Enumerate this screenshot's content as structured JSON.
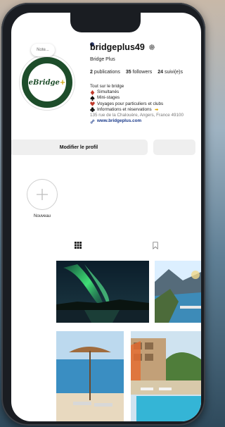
{
  "profile": {
    "username": "bridgeplus49",
    "display_name": "Bridge Plus",
    "note": "Note...",
    "avatar_logo": {
      "prefix": "e",
      "main": "Bridge",
      "suffix": "+"
    }
  },
  "stats": {
    "publications_count": "2",
    "publications_label": "publications",
    "followers_count": "35",
    "followers_label": "followers",
    "following_count": "24",
    "following_label": "suivi(e)s"
  },
  "bio": {
    "intro": "Tout sur le bridge",
    "items": [
      {
        "icon": "diamond-suit-icon",
        "text": "Simultanés",
        "color": "#c0392b"
      },
      {
        "icon": "spade-suit-icon",
        "text": "Mini-stages",
        "color": "#111111"
      },
      {
        "icon": "heart-suit-icon",
        "text": "Voyages pour particuliers et clubs",
        "color": "#c0392b"
      },
      {
        "icon": "club-suit-icon",
        "text": "Informations et réservations",
        "color": "#111111"
      }
    ],
    "address": "135 rue de la Chalouère, Angers, France 49100",
    "link": "www.bridgeplus.com"
  },
  "buttons": {
    "edit_profile": "Modifier le profil",
    "secondary": ""
  },
  "highlights": {
    "new_label": "Nouveau"
  },
  "tabs": [
    {
      "name": "grid",
      "icon": "grid-icon"
    },
    {
      "name": "tagged",
      "icon": "bookmark-icon"
    }
  ],
  "colors": {
    "brand_green": "#1d4d2a",
    "accent_gold": "#c9a000",
    "link_blue": "#1a3a8a"
  }
}
